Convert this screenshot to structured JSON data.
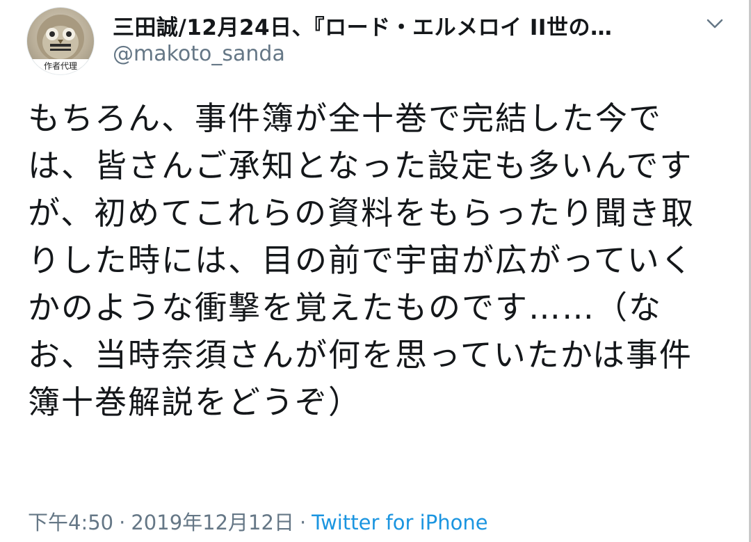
{
  "tweet": {
    "display_name": "三田誠/12月24日、『ロード・エルメロイ II世の…",
    "handle": "@makoto_sanda",
    "avatar_caption": "作者代理",
    "text": "もちろん、事件簿が全十巻で完結した今では、皆さんご承知となった設定も多いんですが、初めてこれらの資料をもらったり聞き取りした時には、目の前で宇宙が広がっていくかのような衝撃を覚えたものです……（なお、当時奈須さんが何を思っていたかは事件簿十巻解説をどうぞ）",
    "time": "下午4:50",
    "separator": "·",
    "date": "2019年12月12日",
    "source": "Twitter for iPhone",
    "chevron_icon": "chevron-down-icon"
  },
  "colors": {
    "text": "#14171a",
    "secondary": "#657786",
    "link": "#1b95e0"
  }
}
